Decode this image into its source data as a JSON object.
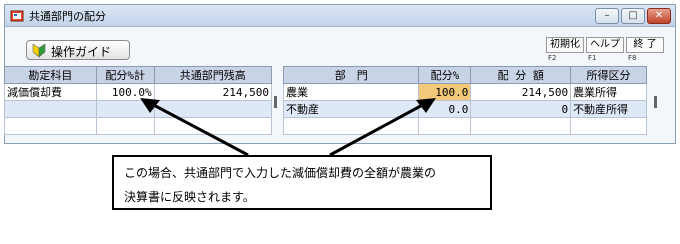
{
  "window": {
    "title": "共通部門の配分",
    "controls": {
      "minimize": "–",
      "maximize": "□",
      "close": "✕"
    }
  },
  "toolbar": {
    "guide_label": "操作ガイド",
    "fkeys": [
      {
        "label": "初期化",
        "key": "F2"
      },
      {
        "label": "ヘルプ",
        "key": "F1"
      },
      {
        "label": "終 了",
        "key": "F8"
      }
    ]
  },
  "left_grid": {
    "headers": [
      "勘定科目",
      "配分%計",
      "共通部門残高"
    ],
    "row": {
      "account": "減価償却費",
      "percent": "100.0%",
      "balance": "214,500"
    }
  },
  "right_grid": {
    "headers": [
      "部　門",
      "配分%",
      "配 分 額",
      "所得区分"
    ],
    "rows": [
      {
        "dept": "農業",
        "percent": "100.0",
        "amount": "214,500",
        "category": "農業所得"
      },
      {
        "dept": "不動産",
        "percent": "0.0",
        "amount": "0",
        "category": "不動産所得"
      }
    ]
  },
  "callout": {
    "line1": "この場合、共通部門で入力した減価償却費の全額が農業の",
    "line2": "決算書に反映されます。"
  },
  "colors": {
    "highlight": "#f2c97a",
    "header_bg": "#c8d4e6",
    "title_bar": "#c3d4ea"
  }
}
